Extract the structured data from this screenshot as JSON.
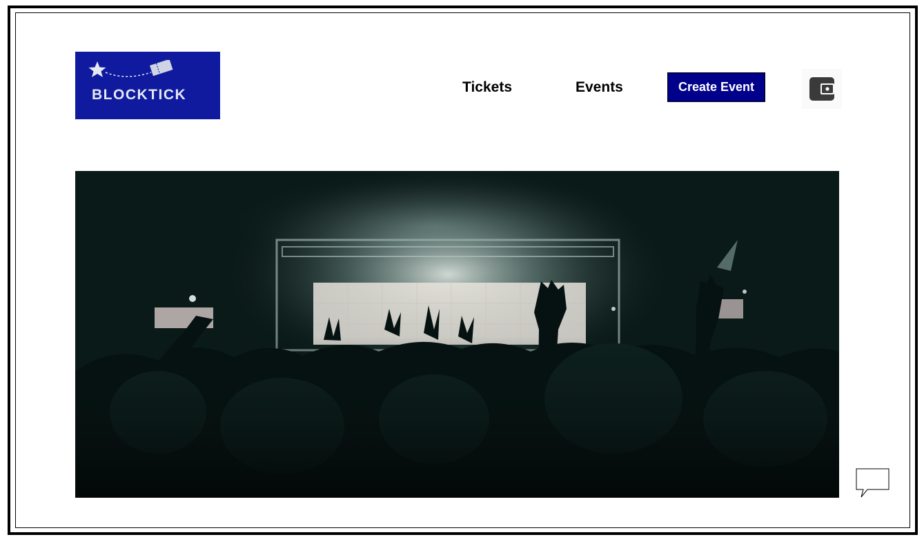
{
  "header": {
    "brand": {
      "name": "BLOCKTICK",
      "icon": "star-ticket-logo",
      "color": "#0f1a9e"
    },
    "nav": [
      {
        "label": "Tickets"
      },
      {
        "label": "Events"
      }
    ],
    "create_event_label": "Create Event",
    "wallet_icon": "wallet-icon"
  },
  "hero": {
    "image": "concert-crowd-photo"
  },
  "chat_icon": "speech-bubble-icon",
  "colors": {
    "accent": "#00008b",
    "frame": "#000000",
    "top_cut_text": "#8b1a1a"
  }
}
